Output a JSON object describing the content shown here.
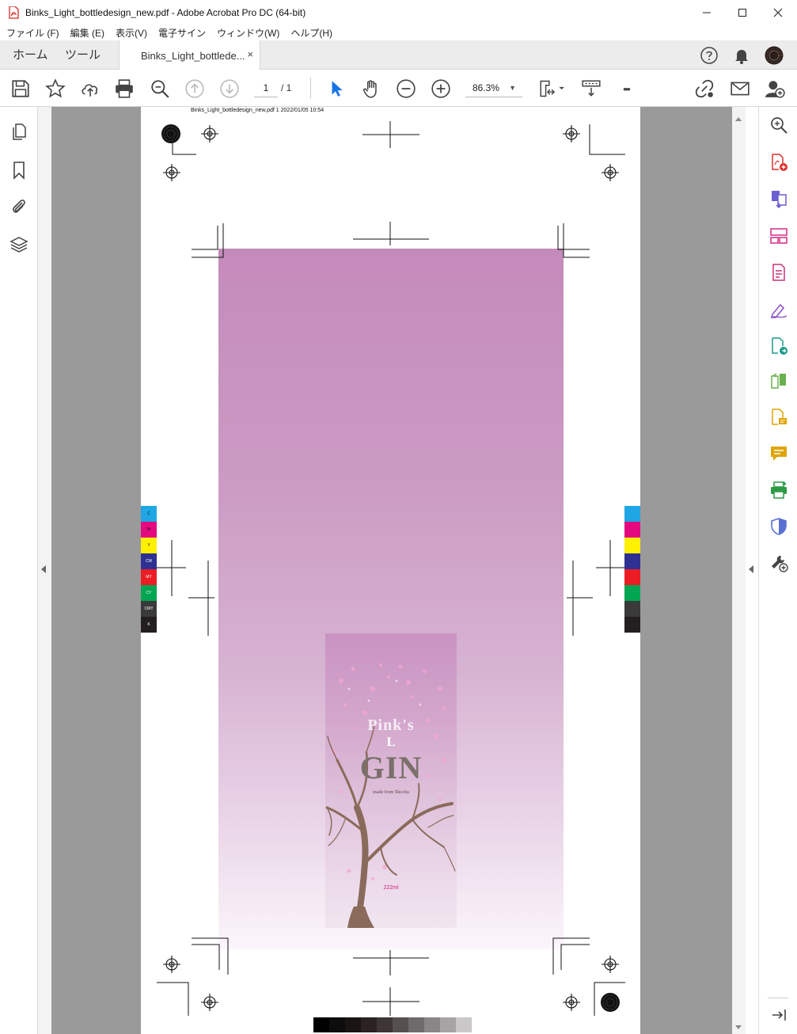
{
  "window": {
    "title": "Binks_Light_bottledesign_new.pdf - Adobe Acrobat Pro DC (64-bit)",
    "minimize_icon": "minimize-icon",
    "maximize_icon": "maximize-icon",
    "close_icon": "close-icon"
  },
  "menu": {
    "items": [
      "ファイル (F)",
      "編集 (E)",
      "表示(V)",
      "電子サイン",
      "ウィンドウ(W)",
      "ヘルプ(H)"
    ]
  },
  "tabs": {
    "home": "ホーム",
    "tools": "ツール",
    "document": "Binks_Light_bottlede...",
    "close_glyph": "×"
  },
  "toolbar": {
    "page_current": "1",
    "page_total": "/ 1",
    "zoom": "86.3%",
    "dropdown_glyph": "▼",
    "more_glyph": "•••"
  },
  "document": {
    "header_line": "Binks_Light_bottledesign_new.pdf  1   2022/01/05   10:54",
    "label": {
      "brand_line1": "Pink's",
      "brand_line2": "L",
      "brand_line3": "GIN",
      "tagline": "made from Shochu",
      "volume": "222ml"
    },
    "color_bars_left": [
      {
        "code": "C",
        "color": "#1ea7e4"
      },
      {
        "code": "M",
        "color": "#e5097f"
      },
      {
        "code": "Y",
        "color": "#fff100"
      },
      {
        "code": "CM",
        "color": "#2e3192"
      },
      {
        "code": "MY",
        "color": "#ec1c24"
      },
      {
        "code": "CY",
        "color": "#00a651"
      },
      {
        "code": "CMY",
        "color": "#3a3a3a"
      },
      {
        "code": "K",
        "color": "#231f20"
      }
    ],
    "color_bars_right": [
      "#1ea7e4",
      "#e5097f",
      "#fff100",
      "#2e3192",
      "#ec1c24",
      "#00a651",
      "#3a3a3a",
      "#231f20"
    ],
    "gray_steps": [
      "#000000",
      "#0d0d0d",
      "#1b1415",
      "#2a2223",
      "#3e3536",
      "#575050",
      "#6f6a6b",
      "#8a8586",
      "#a8a4a5",
      "#cac8c8"
    ]
  },
  "colors": {
    "accent_blue": "#1473e6",
    "artwork_top": "#c48abb",
    "viewport_bg": "#9a9a9a"
  }
}
